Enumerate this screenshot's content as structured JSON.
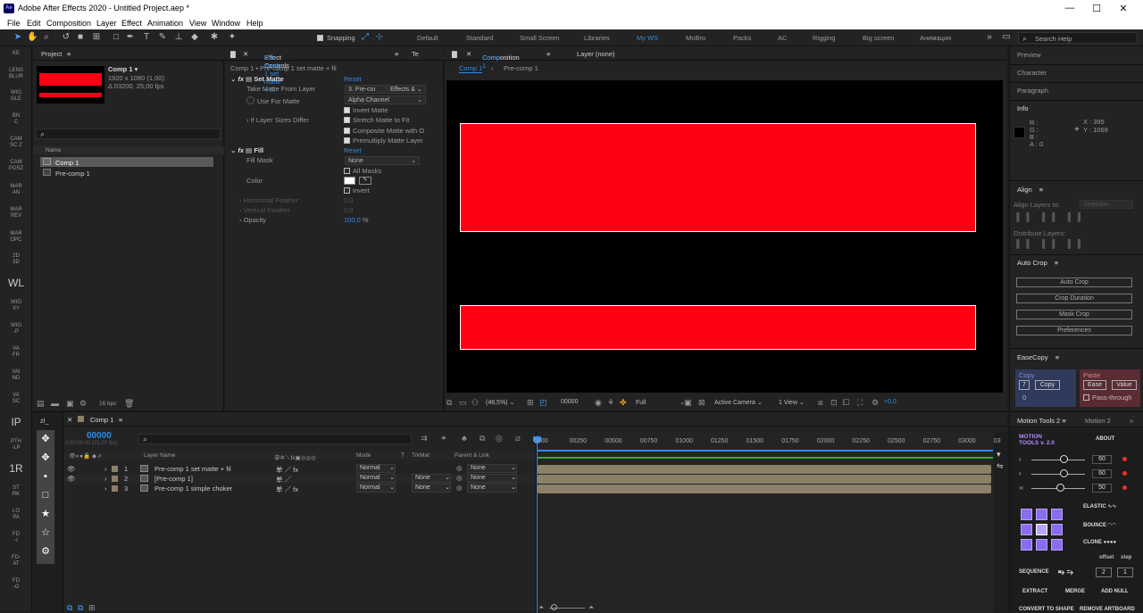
{
  "app": {
    "title": "Adobe After Effects 2020 - Untitled Project.aep *",
    "logo": "Ae"
  },
  "menu": [
    "File",
    "Edit",
    "Composition",
    "Layer",
    "Effect",
    "Animation",
    "View",
    "Window",
    "Help"
  ],
  "toolbar": {
    "snapping": "Snapping",
    "search_placeholder": "Search Help"
  },
  "workspaces": [
    "Default",
    "Standard",
    "Small Screen",
    "Libraries",
    "My WS",
    "MoBro",
    "Packs",
    "AC",
    "Rigging",
    "Big screen",
    "Анимация"
  ],
  "left_rail": [
    "KE",
    "LENS\nBLUR",
    "WIG\nGLE",
    "BN\nC",
    "CAM\nSC Z",
    "CAM\nPOSZ",
    "MAR\nAN",
    "MAR\nREV",
    "MAR\nOPC",
    "2D\n3D",
    "WL",
    "WIG\nXY",
    "WIG\n-P",
    "VA\nFR",
    "VAI\nND",
    "VA\nSC",
    "IP",
    "PTH\n-LP",
    "1R",
    "ST\nRK",
    "LO\nPA",
    "FD\n-I",
    "FD-\nAT",
    "FD\n-O"
  ],
  "project": {
    "title": "Project",
    "comp_name": "Comp 1",
    "comp_size": "1920 x 1080 (1,00)",
    "comp_dur": "Δ 03200, 25,00 fps",
    "col_name": "Name",
    "items": [
      "Comp 1",
      "Pre-comp 1"
    ],
    "bpc": "16 bpc"
  },
  "effects": {
    "tab": "Effect Controls",
    "tab_target": "Pre-comp 1 set matte + fil",
    "tab2": "Te",
    "breadcrumb": "Comp 1 • Pre-comp 1 set matte + fil",
    "set_matte": "Set Matte",
    "reset": "Reset",
    "take_matte": "Take Matte From Layer",
    "take_val": "3. Pre-coı",
    "take_val2": "Effects &",
    "use_for": "Use For Matte",
    "use_val": "Alpha Channel",
    "invert_matte": "Invert Matte",
    "if_layer": "If Layer Sizes Differ",
    "stretch": "Stretch Matte to Fit",
    "composite": "Composite Matte with O",
    "premult": "Premultiply Matte Layer",
    "fill": "Fill",
    "fill_mask": "Fill Mask",
    "fill_mask_val": "None",
    "all_masks": "All Masks",
    "color": "Color",
    "invert": "Invert",
    "h_feather": "Horizontal Feather",
    "h_val": "0,0",
    "v_feather": "Vertical Feather",
    "v_val": "0,0",
    "opacity": "Opacity",
    "opacity_val": "100,0",
    "pct": "%"
  },
  "comp": {
    "tab": "Composition",
    "tab_target": "Comp 1",
    "layer_tab": "Layer (none)",
    "crumb1": "Comp 1",
    "crumb2": "Pre-comp 1",
    "zoom": "(48,5%)",
    "timecode": "00000",
    "quality": "Full",
    "camera": "Active Camera",
    "view": "1 View",
    "exposure": "+0,0"
  },
  "right": {
    "preview": "Preview",
    "character": "Character",
    "paragraph": "Paragraph",
    "info": "Info",
    "r": "R :",
    "g": "G :",
    "b": "B :",
    "a": "A :  0",
    "x": "X : 395",
    "y": "Y : 1069",
    "align": "Align",
    "align_to": "Align Layers to:",
    "align_sel": "Selection",
    "distribute": "Distribute Layers:",
    "autocrop": "Auto Crop",
    "ac_buttons": [
      "Auto Crop",
      "Crop Duration",
      "Mask Crop",
      "Preferences"
    ],
    "easecopy": "EaseCopy",
    "copy": "Copy",
    "paste": "Paste",
    "copy_btn": "Copy",
    "num": "7",
    "zero": "0",
    "ease": "Ease",
    "value": "Value",
    "passthrough": "Pass-through"
  },
  "motion": {
    "tab1": "Motion Tools 2",
    "tab2": "Motion 2",
    "logo1": "MOTION",
    "logo2": "TOOLS v. 2.0",
    "about": "ABOUT",
    "v1": "60",
    "v2": "60",
    "v3": "50",
    "elastic": "ELASTIC",
    "bounce": "BOUNCE",
    "clone": "CLONE",
    "offset": "offset",
    "step": "step",
    "sequence": "SEQUENCE",
    "seq1": "2",
    "seq2": "1",
    "extract": "EXTRACT",
    "merge": "MERGE",
    "addnull": "ADD NULL",
    "convert": "CONVERT TO SHAPE",
    "remove": "REMOVE ARTBOARD"
  },
  "timeline": {
    "tab": "Comp 1",
    "timecode": "00000",
    "subtime": "0:00:00:00 (25.00 fps)",
    "col_layer": "Layer Name",
    "col_mode": "Mode",
    "col_t": "T",
    "col_trk": "TrkMat",
    "col_parent": "Parent & Link",
    "layers": [
      {
        "num": "1",
        "name": "Pre-comp 1 set matte + fil",
        "mode": "Normal",
        "trk": "",
        "parent": "None"
      },
      {
        "num": "2",
        "name": "[Pre-comp 1]",
        "mode": "Normal",
        "trk": "None",
        "parent": "None"
      },
      {
        "num": "3",
        "name": "Pre-comp 1 simple choker",
        "mode": "Normal",
        "trk": "None",
        "parent": "None"
      }
    ],
    "ticks": [
      "0000",
      "00250",
      "00500",
      "00750",
      "01000",
      "01250",
      "01500",
      "01750",
      "02000",
      "02250",
      "02500",
      "02750",
      "03000",
      "03"
    ]
  },
  "colors": {
    "accent": "#2d8ceb",
    "matte_red": "#ff0013",
    "purple": "#8a6cf0"
  }
}
